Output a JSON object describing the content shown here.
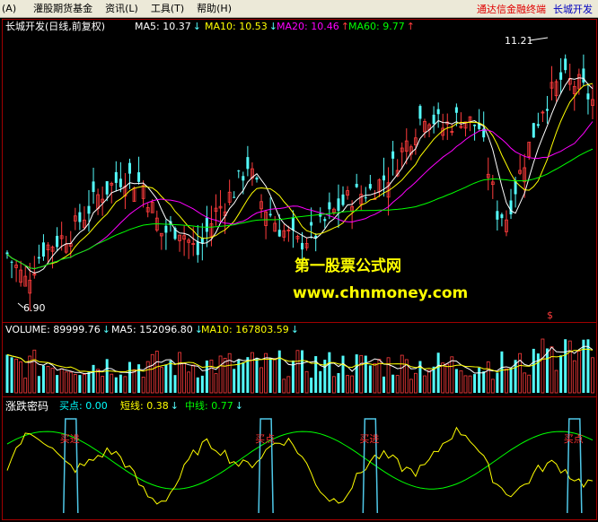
{
  "menu": {
    "items": [
      "(A)",
      "灌股期货基金",
      "资讯(L)",
      "工具(T)",
      "帮助(H)"
    ],
    "promo_link": "通达信金融终端",
    "stock_link": "长城开发"
  },
  "price_panel": {
    "title": "长城开发(日线,前复权)",
    "ma": [
      {
        "label": "MA5: 10.37",
        "arrow": "↓",
        "color": "#ffffff"
      },
      {
        "label": "MA10: 10.53",
        "arrow": "↓",
        "color": "#ffff00"
      },
      {
        "label": "MA20: 10.46",
        "arrow": "↑",
        "color": "#ff00ff"
      },
      {
        "label": "MA60: 9.77",
        "arrow": "↑",
        "color": "#00ff00"
      }
    ],
    "high_label": "11.21",
    "low_label": "6.90",
    "watermark_line1": "第一股票公式网",
    "watermark_line2": "www.chnmoney.com",
    "marker": "$"
  },
  "volume_panel": {
    "label": "VOLUME: 89999.76",
    "label_arrow": "↓",
    "ma": [
      {
        "label": "MA5: 152096.80",
        "arrow": "↓",
        "color": "#ffffff"
      },
      {
        "label": "MA10: 167803.59",
        "arrow": "↓",
        "color": "#ffff00"
      }
    ]
  },
  "indicator_panel": {
    "name": "涨跌密码",
    "values": [
      {
        "label": "买点: 0.00",
        "color": "#00ffff"
      },
      {
        "label": "短线: 0.38",
        "arrow": "↓",
        "color": "#ffff00"
      },
      {
        "label": "中线: 0.77",
        "arrow": "↓",
        "color": "#00ff00"
      }
    ],
    "signals": [
      {
        "text": "买进",
        "bar": 14
      },
      {
        "text": "买点",
        "bar": 57
      },
      {
        "text": "买进",
        "bar": 80
      },
      {
        "text": "买点",
        "bar": 125
      }
    ]
  },
  "colors": {
    "up": "#ff3c3c",
    "down": "#54fcfc",
    "ma5": "#ffffff",
    "ma10": "#ffff00",
    "ma20": "#ff00ff",
    "ma60": "#00ff00",
    "grid": "#a00000",
    "watermark": "#ffff00",
    "signal_text": "#ff3030"
  },
  "chart_data": {
    "type": "candlestick",
    "bar_count": 130,
    "price_range": [
      6.5,
      11.6
    ],
    "high": 11.21,
    "low": 6.9,
    "close_trend": [
      [
        0,
        7.5
      ],
      [
        4,
        7.0
      ],
      [
        8,
        7.6
      ],
      [
        14,
        7.9
      ],
      [
        20,
        8.6
      ],
      [
        26,
        9.0
      ],
      [
        30,
        8.8
      ],
      [
        34,
        7.9
      ],
      [
        38,
        8.0
      ],
      [
        42,
        7.5
      ],
      [
        46,
        8.3
      ],
      [
        50,
        8.7
      ],
      [
        53,
        9.2
      ],
      [
        56,
        8.5
      ],
      [
        60,
        8.0
      ],
      [
        64,
        7.7
      ],
      [
        68,
        7.9
      ],
      [
        72,
        8.3
      ],
      [
        76,
        8.6
      ],
      [
        80,
        8.7
      ],
      [
        84,
        9.0
      ],
      [
        88,
        9.6
      ],
      [
        92,
        10.2
      ],
      [
        96,
        9.9
      ],
      [
        100,
        10.1
      ],
      [
        104,
        9.9
      ],
      [
        106,
        9.1
      ],
      [
        108,
        8.3
      ],
      [
        110,
        8.2
      ],
      [
        114,
        9.3
      ],
      [
        118,
        10.3
      ],
      [
        122,
        10.8
      ],
      [
        126,
        10.7
      ],
      [
        129,
        10.4
      ]
    ]
  }
}
